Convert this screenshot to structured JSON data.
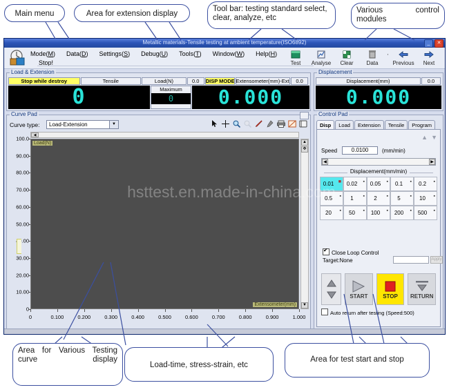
{
  "callouts": {
    "main_menu": "Main menu",
    "extension_display": "Area for extension display",
    "toolbar": "Tool bar: testing standard select, clear, analyze, etc",
    "modules": "Various control modules",
    "testing_display": "Area for Various Testing curve display",
    "curve_types": "Load-time, stress-strain, etc",
    "start_stop": "Area for test start and stop"
  },
  "window": {
    "title": "Metallic materials-Tensile testing at ambient temperature(ISO6892)",
    "minimize": "_",
    "close": "✕"
  },
  "menu": {
    "items": [
      {
        "label": "Mode",
        "key": "M"
      },
      {
        "label": "Data",
        "key": "D"
      },
      {
        "label": "Settings",
        "key": "S"
      },
      {
        "label": "Debug",
        "key": "U"
      },
      {
        "label": "Tools",
        "key": "T"
      },
      {
        "label": "Window",
        "key": "W"
      },
      {
        "label": "Help",
        "key": "H"
      }
    ],
    "status": "Stop!"
  },
  "toolbar": {
    "buttons": [
      {
        "label": "Test",
        "icon": "test-icon"
      },
      {
        "label": "Analyse",
        "icon": "analyse-icon"
      },
      {
        "label": "Clear",
        "icon": "clear-icon"
      },
      {
        "label": "Data",
        "icon": "data-icon"
      },
      {
        "label": "Previous",
        "icon": "previous-icon"
      },
      {
        "label": "Next",
        "icon": "next-icon"
      }
    ],
    "separator": "·"
  },
  "load_extension": {
    "caption": "Load & Extension",
    "mode_label": "Stop while destroy",
    "test_type": "Tensile",
    "load_unit": "Load(N)",
    "load_decimals": "0.0",
    "load_value": "0",
    "maximum_label": "Maximum",
    "maximum_value": "0",
    "disp_mode": "DISP MODE",
    "extensometer_label": "Extensometer(mm)-Extensometer",
    "extensometer_decimals": "0.0",
    "extensometer_value": "0.000"
  },
  "displacement": {
    "caption": "Displacement",
    "label": "Displacement(mm)",
    "decimals": "0.0",
    "value": "0.000"
  },
  "curve_pad": {
    "caption": "Curve Pad",
    "curve_type_label": "Curve type:",
    "curve_type_value": "Load-Extension",
    "dropdown_arrow": "▼",
    "tools": [
      {
        "name": "pointer-icon",
        "glyph": "➤"
      },
      {
        "name": "crosshair-icon",
        "glyph": "✛"
      },
      {
        "name": "zoom-in-icon",
        "glyph": "🔍"
      },
      {
        "name": "zoom-out-icon",
        "glyph": "🔍"
      },
      {
        "name": "pencil-icon",
        "glyph": "✎"
      },
      {
        "name": "eyedropper-icon",
        "glyph": "⚲"
      },
      {
        "name": "print-icon",
        "glyph": "⎙"
      },
      {
        "name": "export-icon",
        "glyph": "▱"
      },
      {
        "name": "copy-icon",
        "glyph": "❏"
      }
    ],
    "minimize": "▭"
  },
  "chart_data": {
    "type": "line",
    "title": "",
    "xlabel": "Extensometer(mm)",
    "ylabel": "Load(N)",
    "xlim": [
      0,
      1.0
    ],
    "ylim": [
      0,
      100.0
    ],
    "grid": false,
    "x_ticks": [
      "0",
      "0.100",
      "0.200",
      "0.300",
      "0.400",
      "0.500",
      "0.600",
      "0.700",
      "0.800",
      "0.900",
      "1.000"
    ],
    "y_ticks": [
      "100.0",
      "90.00",
      "80.00",
      "70.00",
      "60.00",
      "50.00",
      "40.00",
      "30.00",
      "20.00",
      "10.00",
      "0"
    ],
    "series": [
      {
        "name": "Load-Extension",
        "x": [],
        "y": []
      }
    ],
    "plot_background": "#4d4d4d",
    "axis_label_background": "#b9b978"
  },
  "watermark": "hsttest.en.made-in-china.com",
  "control_pad": {
    "caption": "Control Pad",
    "tabs": [
      {
        "label": "Disp",
        "selected": true
      },
      {
        "label": "Load",
        "selected": false
      },
      {
        "label": "Extension",
        "selected": false
      },
      {
        "label": "Tensile",
        "selected": false
      },
      {
        "label": "Program",
        "selected": false
      }
    ],
    "speed_label": "Speed",
    "speed_value": "0.0100",
    "speed_unit": "(mm/min)",
    "slider_left": "◀",
    "slider_right": "▶",
    "section_header": "Displacement(mm/min)",
    "speed_buttons": [
      {
        "value": "0.01",
        "selected": true
      },
      {
        "value": "0.02",
        "selected": false
      },
      {
        "value": "0.05",
        "selected": false
      },
      {
        "value": "0.1",
        "selected": false
      },
      {
        "value": "0.2",
        "selected": false
      },
      {
        "value": "0.5",
        "selected": false
      },
      {
        "value": "1",
        "selected": false
      },
      {
        "value": "2",
        "selected": false
      },
      {
        "value": "5",
        "selected": false
      },
      {
        "value": "10",
        "selected": false
      },
      {
        "value": "20",
        "selected": false
      },
      {
        "value": "50",
        "selected": false
      },
      {
        "value": "100",
        "selected": false
      },
      {
        "value": "200",
        "selected": false
      },
      {
        "value": "500",
        "selected": false
      }
    ],
    "close_loop_label": "Close Loop Control",
    "close_loop_checked": true,
    "target_label": "Target:None",
    "target_value": "",
    "target_button": "Apply",
    "jog_up": "▲",
    "jog_down": "▼",
    "start_label": "START",
    "stop_label": "STOP",
    "return_label": "RETURN",
    "auto_return_label": "Auto return after testing (Speed:500)",
    "auto_return_checked": false
  }
}
